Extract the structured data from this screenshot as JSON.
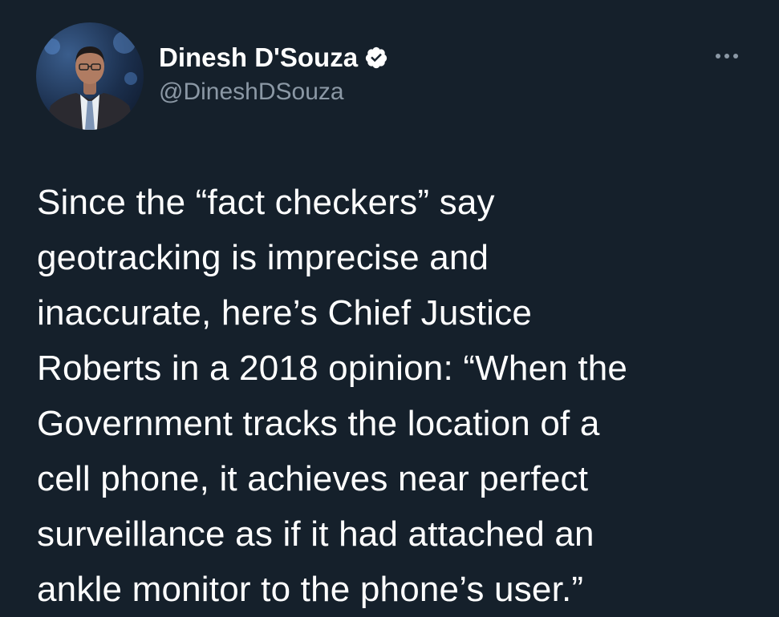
{
  "author": {
    "display_name": "Dinesh D'Souza",
    "handle": "@DineshDSouza",
    "verified": true,
    "avatar_icon": "profile-photo"
  },
  "actions": {
    "more_icon": "more-horizontal-icon"
  },
  "tweet": {
    "lines": [
      "Since the “fact checkers” say",
      "geotracking is imprecise and",
      "inaccurate, here’s Chief Justice",
      "Roberts in a 2018 opinion: “When the",
      "Government tracks the location of a",
      "cell phone, it achieves near perfect",
      "surveillance as if it had attached an",
      "ankle monitor to the phone’s user.”"
    ]
  },
  "colors": {
    "background": "#15202b",
    "text": "#ffffff",
    "secondary_text": "#8b98a5",
    "verified": "#ffffff"
  }
}
